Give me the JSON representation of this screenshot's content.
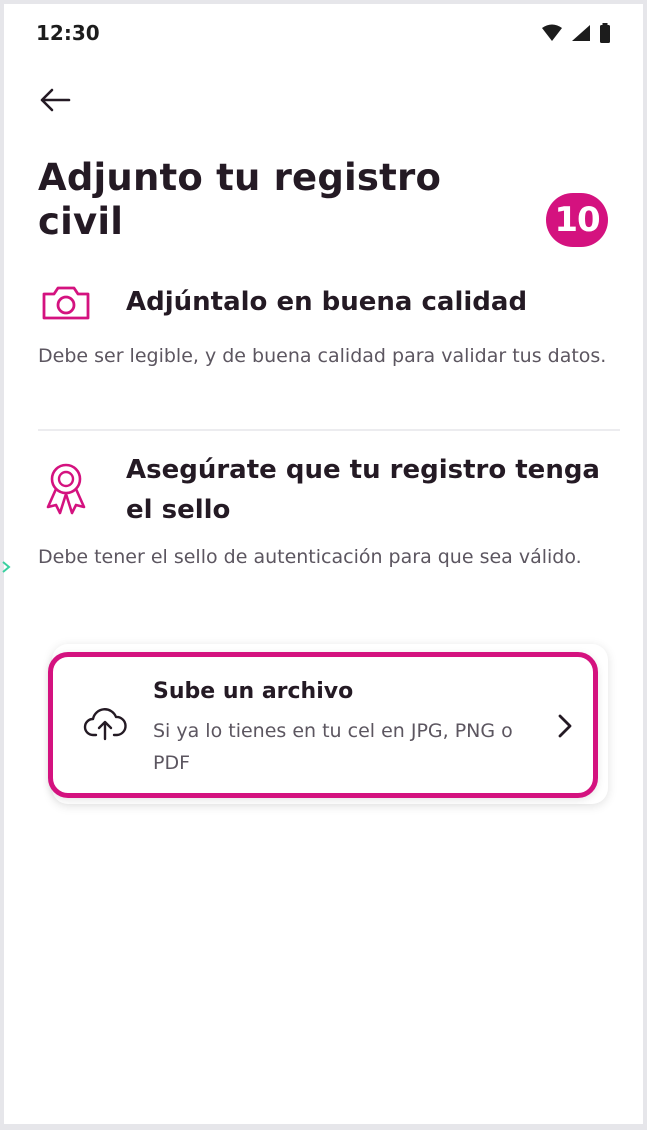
{
  "status_bar": {
    "time": "12:30"
  },
  "header": {
    "title": "Adjunto tu registro civil",
    "step_badge": "10"
  },
  "tips": [
    {
      "icon": "camera-icon",
      "heading": "Adjúntalo en buena calidad",
      "text": "Debe ser legible, y de buena calidad para validar tus datos."
    },
    {
      "icon": "award-ribbon-icon",
      "heading": "Asegúrate que tu registro tenga el sello",
      "text": "Debe tener el sello de autenticación para que sea válido."
    }
  ],
  "upload": {
    "icon": "cloud-upload-icon",
    "title": "Sube un archivo",
    "description": "Si ya lo tienes en tu cel en JPG, PNG o PDF"
  },
  "colors": {
    "accent": "#d4127f",
    "text_primary": "#241a24",
    "text_secondary": "#5c5660"
  }
}
